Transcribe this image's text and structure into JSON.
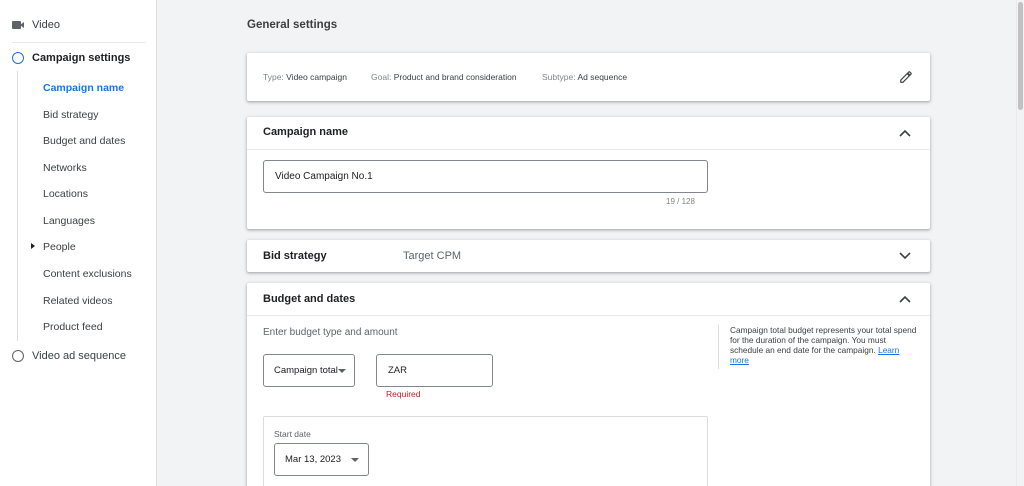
{
  "sidebar": {
    "top_item": {
      "label": "Video",
      "icon": "video-icon"
    },
    "steps": [
      {
        "label": "Campaign settings",
        "active": true
      },
      {
        "label": "Video ad sequence",
        "active": false
      }
    ],
    "sub_items": [
      {
        "label": "Campaign name",
        "current": true
      },
      {
        "label": "Bid strategy"
      },
      {
        "label": "Budget and dates"
      },
      {
        "label": "Networks"
      },
      {
        "label": "Locations"
      },
      {
        "label": "Languages"
      },
      {
        "label": "People",
        "expandable": true
      },
      {
        "label": "Content exclusions"
      },
      {
        "label": "Related videos"
      },
      {
        "label": "Product feed"
      }
    ]
  },
  "main": {
    "title": "General settings",
    "summary": {
      "type_label": "Type:",
      "type_value": "Video campaign",
      "goal_label": "Goal:",
      "goal_value": "Product and brand consideration",
      "subtype_label": "Subtype:",
      "subtype_value": "Ad sequence"
    },
    "campaign_name": {
      "title": "Campaign name",
      "value": "Video Campaign No.1",
      "counter": "19 / 128"
    },
    "bid_strategy": {
      "title": "Bid strategy",
      "value": "Target CPM"
    },
    "budget": {
      "title": "Budget and dates",
      "hint": "Enter budget type and amount",
      "budget_type": "Campaign total",
      "currency": "ZAR",
      "required": "Required",
      "info_text": "Campaign total budget represents your total spend for the duration of the campaign. You must schedule an end date for the campaign.",
      "learn_more": "Learn more",
      "start_date_label": "Start date",
      "start_date": "Mar 13, 2023"
    }
  },
  "colors": {
    "accent": "#1a73e8",
    "error": "#c5221f",
    "background": "#f1f3f4"
  }
}
